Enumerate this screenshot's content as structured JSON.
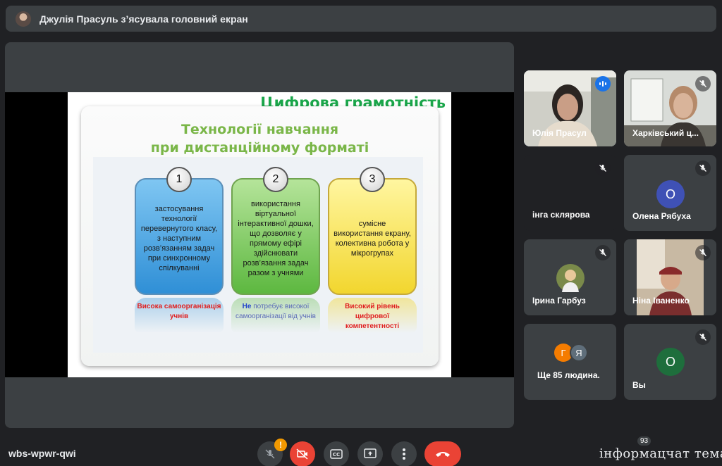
{
  "banner": {
    "text": "Джулія Прасуль з’ясувала головний екран"
  },
  "slide": {
    "title": "Цифрова грамотність",
    "subtitle_line1": "Технології навчання",
    "subtitle_line2": "при дистанційному форматі",
    "cards": [
      {
        "num": "1",
        "text": "застосування технології перевернутого класу, з наступним розв’язанням задач при синхронному спілкуванні"
      },
      {
        "num": "2",
        "text": "використання віртуальної інтерактивної дошки, що дозволяє у прямому ефірі здійснювати розв’язання задач разом з учнями"
      },
      {
        "num": "3",
        "text": "сумісне використання екрану, колективна робота у мікрогрупах"
      }
    ],
    "notes": [
      "Висока самоорганізація учнів",
      {
        "prefix": "Не",
        "rest": " потребує високої самоорганізації від учнів"
      },
      "Високий рівень цифрової компетентності"
    ]
  },
  "tiles": [
    {
      "name": "Юлія Прасул",
      "state": "speaking"
    },
    {
      "name": "Харківський ц...",
      "state": "muted"
    },
    {
      "name": "інга склярова",
      "state": "muted"
    },
    {
      "name": "Олена Рябуха",
      "state": "muted",
      "letter": "О",
      "color": "#3f51b5"
    },
    {
      "name": "Ірина Гарбуз",
      "state": "muted"
    },
    {
      "name": "Ніна Іваненко",
      "state": "muted"
    },
    {
      "name": "Ще 85 людина.",
      "letters": [
        "Г",
        "Я"
      ]
    },
    {
      "name": "Вы",
      "state": "muted",
      "letter": "О",
      "color": "#1e6e3c"
    }
  ],
  "bottom": {
    "meeting_code": "wbs-wpwr-qwi",
    "mic_badge": "!",
    "participants_count": "93",
    "right_text": "інформацчат тема"
  },
  "colors": {
    "end_call": "#ea4335",
    "accent": "#8ab4f8",
    "speaking": "#1a73e8"
  }
}
